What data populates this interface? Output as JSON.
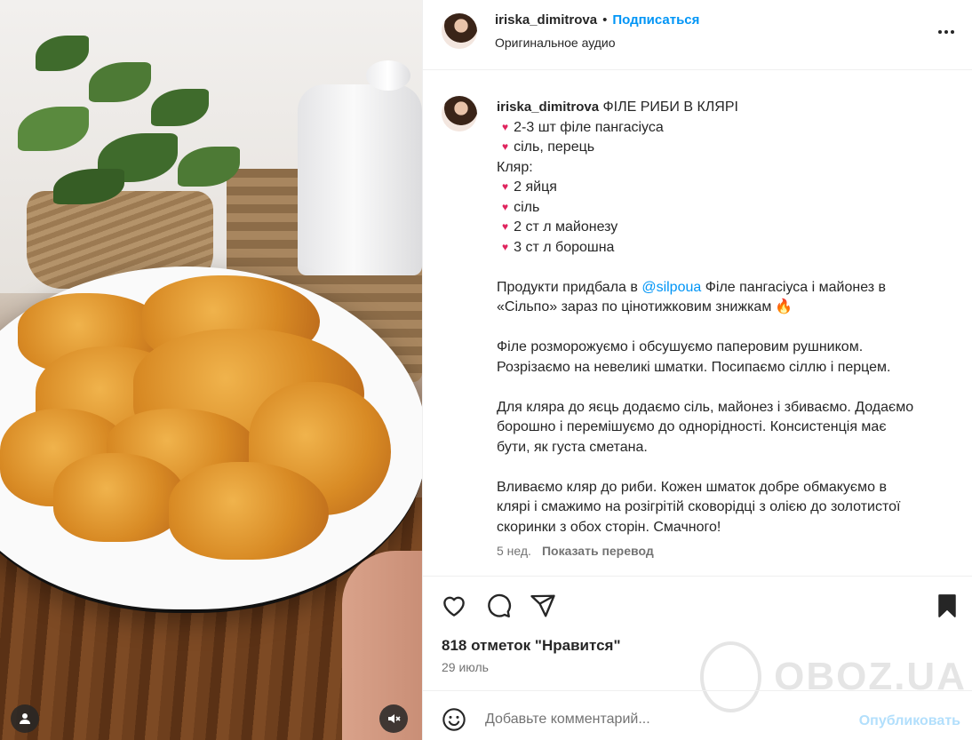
{
  "post": {
    "author": "iriska_dimitrova",
    "dot": "•",
    "follow_label": "Подписаться",
    "audio_label": "Оригинальное аудио",
    "caption": {
      "title": "ФІЛЕ РИБИ В КЛЯРІ",
      "bullet": "♥",
      "ingredients": [
        "2-3 шт філе пангасіуса",
        "сіль, перець"
      ],
      "batter_label": "Кляр:",
      "batter_items": [
        "2 яйця",
        "сіль",
        "2 ст л майонезу",
        "3 ст л борошна"
      ],
      "p1_before": "Продукти придбала в ",
      "p1_mention": "@silpoua",
      "p1_after_line1": " Філе пангасіуса і майонез в",
      "p1_line2": "«Сільпо» зараз по цінотижковим знижкам",
      "fire_emoji": "🔥",
      "p2": [
        "Філе розморожуємо і обсушуємо паперовим рушником.",
        "Розрізаємо на невеликі шматки. Посипаємо сіллю і перцем."
      ],
      "p3": [
        "Для кляра до яєць додаємо сіль, майонез і збиваємо. Додаємо",
        "борошно і перемішуємо до однорідності. Консистенція має",
        "бути, як густа сметана."
      ],
      "p4": [
        "Вливаємо кляр до риби. Кожен шматок добре обмакуємо в",
        "клярі і смажимо на розігрітій сковорідці з олією до золотистої",
        "скоринки з обох сторін. Смачного!"
      ]
    },
    "age": "5 нед.",
    "translate_label": "Показать перевод",
    "likes": "818 отметок \"Нравится\"",
    "date": "29 июль",
    "comment_placeholder": "Добавьте комментарий...",
    "publish_label": "Опубликовать",
    "watermark": "OBOZ.UA"
  },
  "colors": {
    "link": "#0095f6",
    "publish_disabled": "#b2dffc",
    "text": "#262626",
    "secondary": "#737373"
  },
  "icons": [
    "user-icon",
    "mute-icon",
    "more-icon",
    "heart-icon",
    "comment-icon",
    "share-icon",
    "bookmark-icon",
    "emoji-icon"
  ]
}
